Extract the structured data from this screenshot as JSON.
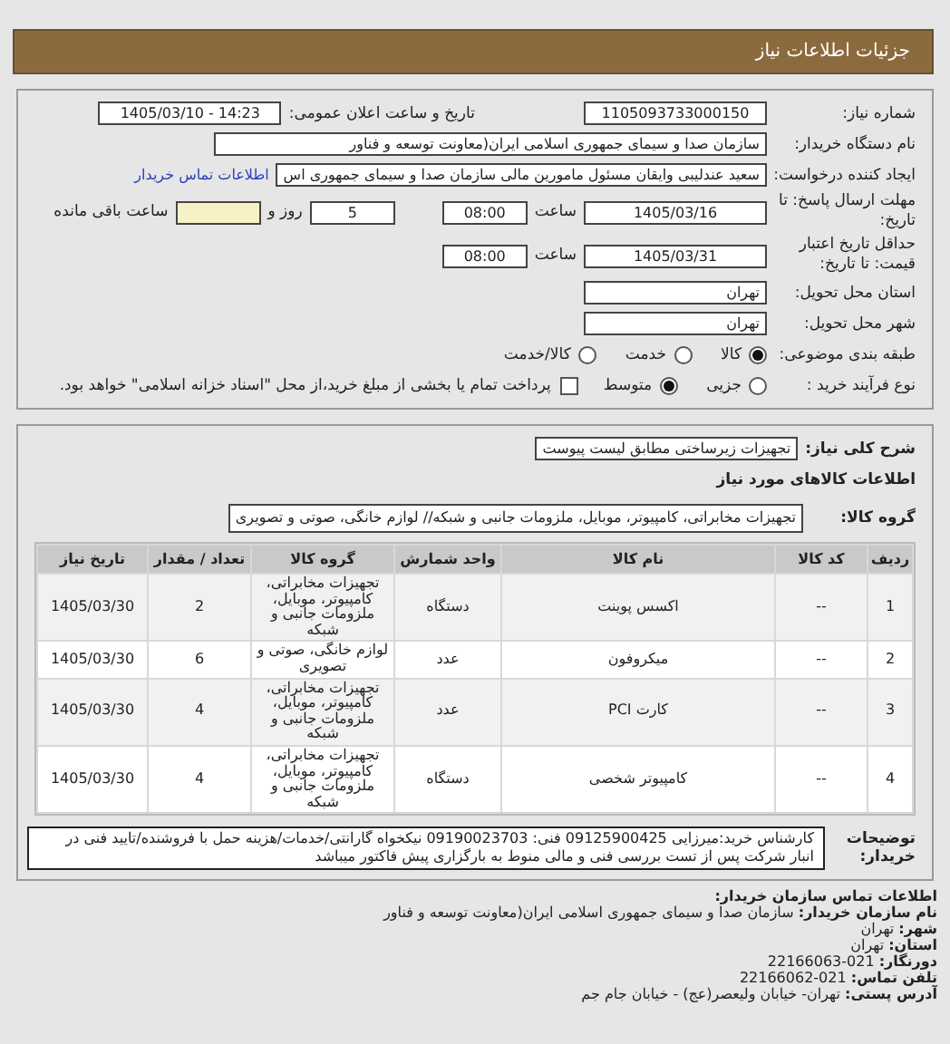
{
  "header": {
    "title": "جزئیات اطلاعات نیاز"
  },
  "details": {
    "need_number": {
      "label": "شماره نیاز:",
      "value": "1105093733000150"
    },
    "announce_datetime": {
      "label": "تاریخ و ساعت اعلان عمومی:",
      "value": "1405/03/10 - 14:23"
    },
    "buyer_org": {
      "label": "نام دستگاه خریدار:",
      "value": "سازمان صدا و سیمای جمهوری اسلامی ایران(معاونت توسعه و فناور"
    },
    "requester": {
      "label": "ایجاد کننده درخواست:",
      "value": "سعید عندلیبی وایقان مسئول مامورین مالی  سازمان صدا و سیمای جمهوری اس",
      "link": "اطلاعات تماس خریدار"
    },
    "reply_deadline": {
      "label": "مهلت ارسال پاسخ: تا تاریخ:",
      "date": "1405/03/16",
      "time_label": "ساعت",
      "time": "08:00",
      "days": "5",
      "days_label": "روز و",
      "remaining_label": "ساعت باقی مانده"
    },
    "price_validity": {
      "label": "حداقل تاریخ اعتبار قیمت: تا تاریخ:",
      "date": "1405/03/31",
      "time_label": "ساعت",
      "time": "08:00"
    },
    "province": {
      "label": "استان محل تحویل:",
      "value": "تهران"
    },
    "city": {
      "label": "شهر محل تحویل:",
      "value": "تهران"
    },
    "category": {
      "label": "طبقه بندی موضوعی:",
      "options": [
        {
          "label": "کالا",
          "selected": true
        },
        {
          "label": "خدمت",
          "selected": false
        },
        {
          "label": "کالا/خدمت",
          "selected": false
        }
      ]
    },
    "process": {
      "label": "نوع فرآیند خرید :",
      "options": [
        {
          "label": "جزیی",
          "selected": false
        },
        {
          "label": "متوسط",
          "selected": true
        }
      ],
      "payment_checkbox": {
        "label": "پرداخت تمام یا بخشی از مبلغ خرید،از محل \"اسناد خزانه اسلامی\" خواهد بود.",
        "checked": false
      }
    }
  },
  "items": {
    "description": {
      "label": "شرح کلی نیاز:",
      "value": "تجهیزات زیرساختی مطابق لیست پیوست"
    },
    "heading": "اطلاعات کالاهای مورد نیاز",
    "goods_group": {
      "label": "گروه کالا:",
      "value": "تجهیزات مخابراتی، کامپیوتر، موبایل، ملزومات جانبی و شبکه// لوازم خانگی، صوتی و تصویری"
    },
    "table": {
      "columns": [
        "ردیف",
        "کد کالا",
        "نام کالا",
        "واحد شمارش",
        "گروه کالا",
        "تعداد / مقدار",
        "تاریخ نیاز"
      ],
      "rows": [
        [
          "1",
          "--",
          "اکسس پوینت",
          "دستگاه",
          "تجهیزات مخابراتی، کامپیوتر، موبایل، ملزومات جانبی و شبکه",
          "2",
          "1405/03/30"
        ],
        [
          "2",
          "--",
          "میکروفون",
          "عدد",
          "لوازم خانگی، صوتی و تصویری",
          "6",
          "1405/03/30"
        ],
        [
          "3",
          "--",
          "کارت PCI",
          "عدد",
          "تجهیزات مخابراتی، کامپیوتر، موبایل، ملزومات جانبی و شبکه",
          "4",
          "1405/03/30"
        ],
        [
          "4",
          "--",
          "کامپیوتر شخصی",
          "دستگاه",
          "تجهیزات مخابراتی، کامپیوتر، موبایل، ملزومات جانبی و شبکه",
          "4",
          "1405/03/30"
        ]
      ]
    },
    "buyer_notes": {
      "label": "توضیحات خریدار:",
      "value": "کارشناس خرید:میرزایی 09125900425 فنی: 09190023703 نیکخواه گارانتی/خدمات/هزینه حمل با فروشنده/تایید فنی در انبار شرکت پس از تست بررسی فنی و مالی منوط به بارگزاری پیش فاکتور میباشد"
    }
  },
  "contact": {
    "title": "اطلاعات تماس سازمان خریدار:",
    "fields": [
      {
        "label": "نام سازمان خریدار:",
        "value": "سازمان صدا و سیمای جمهوری اسلامی ایران(معاونت توسعه و فناور"
      },
      {
        "label": "شهر:",
        "value": "تهران"
      },
      {
        "label": "استان:",
        "value": "تهران"
      },
      {
        "label": "دورنگار:",
        "value": "021-22166063"
      },
      {
        "label": "تلفن تماس:",
        "value": "021-22166062"
      },
      {
        "label": "آدرس پستی:",
        "value": "تهران- خیابان ولیعصر(عج) - خیابان جام جم"
      }
    ]
  }
}
